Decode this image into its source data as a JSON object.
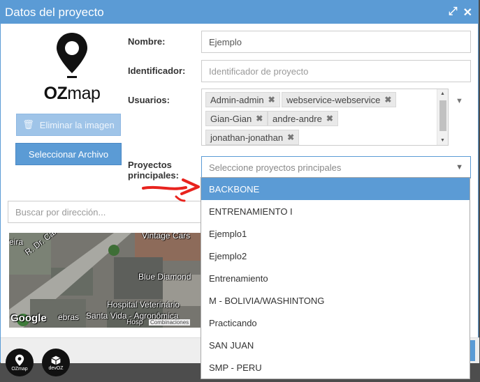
{
  "dialog": {
    "title": "Datos del proyecto"
  },
  "logo": {
    "brand_prefix": "OZ",
    "brand_suffix": "map"
  },
  "buttons": {
    "delete_image": "Eliminar la imagen",
    "select_file": "Seleccionar Archivo"
  },
  "form": {
    "name_label": "Nombre:",
    "name_value": "Ejemplo",
    "identifier_label": "Identificador:",
    "identifier_placeholder": "Identificador de proyecto",
    "users_label": "Usuarios:",
    "users": [
      "Admin-admin",
      "webservice-webservice",
      "Gian-Gian",
      "andre-andre",
      "jonathan-jonathan"
    ],
    "main_projects_label_1": "Proyectos",
    "main_projects_label_2": "principales:",
    "main_projects_placeholder": "Seleccione proyectos principales"
  },
  "dropdown": {
    "options": [
      "BACKBONE",
      "ENTRENAMIENTO I",
      "Ejemplo1",
      "Ejemplo2",
      "Entrenamiento",
      "M - BOLIVIA/WASHINTONG",
      "Practicando",
      "SAN JUAN",
      "SMP - PERU"
    ],
    "highlighted": "BACKBONE"
  },
  "map": {
    "search_placeholder": "Buscar por dirección...",
    "labels": [
      "Vintage Cars",
      "R. Dr. Carlos Corr",
      "Blue Diamond",
      "Hospital Veterinário",
      "Santa Vida - Agronômica",
      "Google",
      "Combinaciones",
      "Hosp",
      "ebras",
      "eira"
    ]
  },
  "taskbar": {
    "icon1": "OZmap",
    "icon2": "devOZ"
  },
  "colors": {
    "accent": "#5b9bd5",
    "arrow": "#e8231e"
  }
}
